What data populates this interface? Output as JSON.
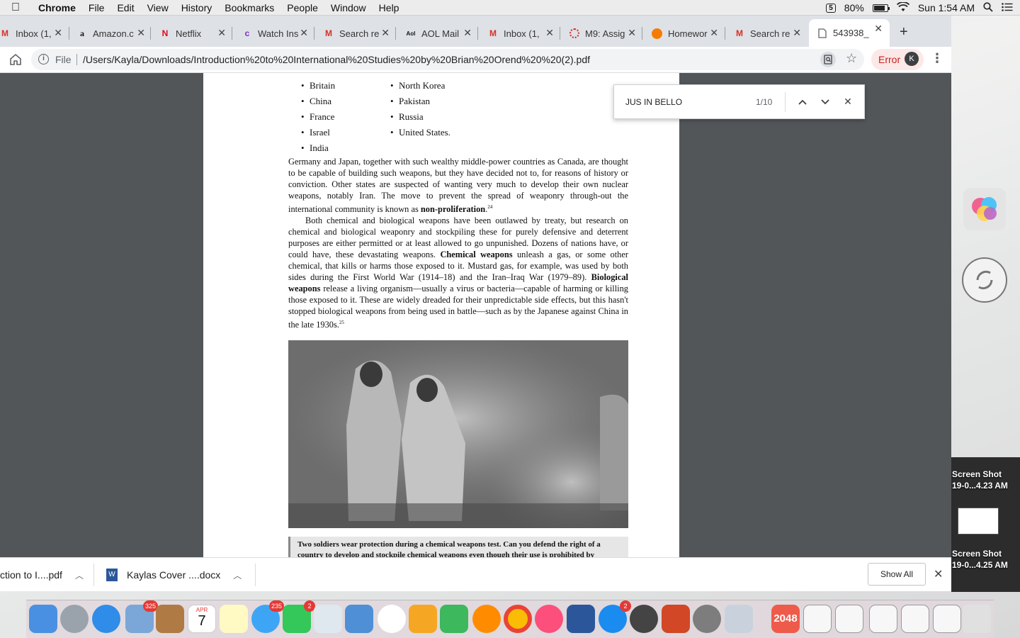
{
  "menubar": {
    "app": "Chrome",
    "items": [
      "File",
      "Edit",
      "View",
      "History",
      "Bookmarks",
      "People",
      "Window",
      "Help"
    ],
    "battery": "80%",
    "clock": "Sun 1:54 AM"
  },
  "tabs": [
    {
      "title": "Inbox (1,",
      "icon": "gmail-icon",
      "color": "#d93025"
    },
    {
      "title": "Amazon.c",
      "icon": "amazon-icon",
      "color": "#111111"
    },
    {
      "title": "Netflix",
      "icon": "netflix-icon",
      "color": "#e50914"
    },
    {
      "title": "Watch Ins",
      "icon": "video-icon",
      "color": "#7b2fbe"
    },
    {
      "title": "Search re",
      "icon": "gmail-icon",
      "color": "#d93025"
    },
    {
      "title": "AOL Mail",
      "icon": "aol-icon",
      "color": "#111111"
    },
    {
      "title": "Inbox (1,",
      "icon": "gmail-icon",
      "color": "#d93025"
    },
    {
      "title": "M9: Assig",
      "icon": "canvas-icon",
      "color": "#d32f2f"
    },
    {
      "title": "Homewor",
      "icon": "homework-icon",
      "color": "#f57c00"
    },
    {
      "title": "Search re",
      "icon": "gmail-icon",
      "color": "#d93025"
    },
    {
      "title": "543938_",
      "icon": "file-icon",
      "color": "#5f6368",
      "active": true
    }
  ],
  "address": {
    "scheme_label": "File",
    "url": "/Users/Kayla/Downloads/Introduction%20to%20International%20Studies%20by%20Brian%20Orend%20%20(2).pdf",
    "error_label": "Error",
    "avatar_letter": "K"
  },
  "find": {
    "query": "JUS IN BELLO",
    "count": "1/10"
  },
  "document": {
    "bullets_col1": [
      "Britain",
      "China",
      "France",
      "Israel",
      "India"
    ],
    "bullets_col2": [
      "North Korea",
      "Pakistan",
      "Russia",
      "United States."
    ],
    "para1_a": "Germany and Japan, together with such wealthy middle-power countries as Canada, are thought to be capable of building such weapons, but they have decided not to, for reasons of history or conviction. Other states are suspected of wanting very much to develop their own nuclear weapons, notably Iran. The move to prevent the spread of weaponry through-out the international community is known as ",
    "para1_bold": "non-proliferation",
    "para1_end": ".",
    "para1_note": "24",
    "para2_a": "Both chemical and biological weapons have been outlawed by treaty, but research on chemical and biological weaponry and stockpiling these for purely defensive and deterrent purposes are either permitted or at least allowed to go unpunished. Dozens of nations have, or could have, these devastating weapons. ",
    "para2_bold1": "Chemical weapons",
    "para2_b": " unleash a gas, or some other chemical, that kills or harms those exposed to it. Mustard gas, for example, was used by both sides during the First World War (1914–18) and the Iran–Iraq War (1979–89). ",
    "para2_bold2": "Biological weapons",
    "para2_c": " release a living organism—usually a virus or bacteria—capable of harming or killing those exposed to it. These are widely dreaded for their unpredictable side effects, but this hasn't stopped biological weapons from being used in battle—such as by the Japanese against China in the late 1930s.",
    "para2_note": "25",
    "caption": "Two soldiers wear protection during a chemical weapons test. Can you defend the right of a country to develop and stockpile chemical weapons even though their use is prohibited by"
  },
  "downloads": [
    {
      "name": "ction to I....pdf",
      "icon": "pdf-icon"
    },
    {
      "name": "Kaylas Cover ....docx",
      "icon": "word-doc-icon"
    }
  ],
  "downloads_show_all": "Show All",
  "desktop": {
    "files": [
      "Screen Shot",
      "19-0...4.23 AM",
      "Screen Shot",
      "19-0...4.25 AM"
    ]
  },
  "dock": {
    "calendar_month": "APR",
    "calendar_day": "7",
    "badges": {
      "mail": "325",
      "messages": "235",
      "facetime": "2",
      "appstore": "2"
    },
    "game_label": "2048"
  }
}
